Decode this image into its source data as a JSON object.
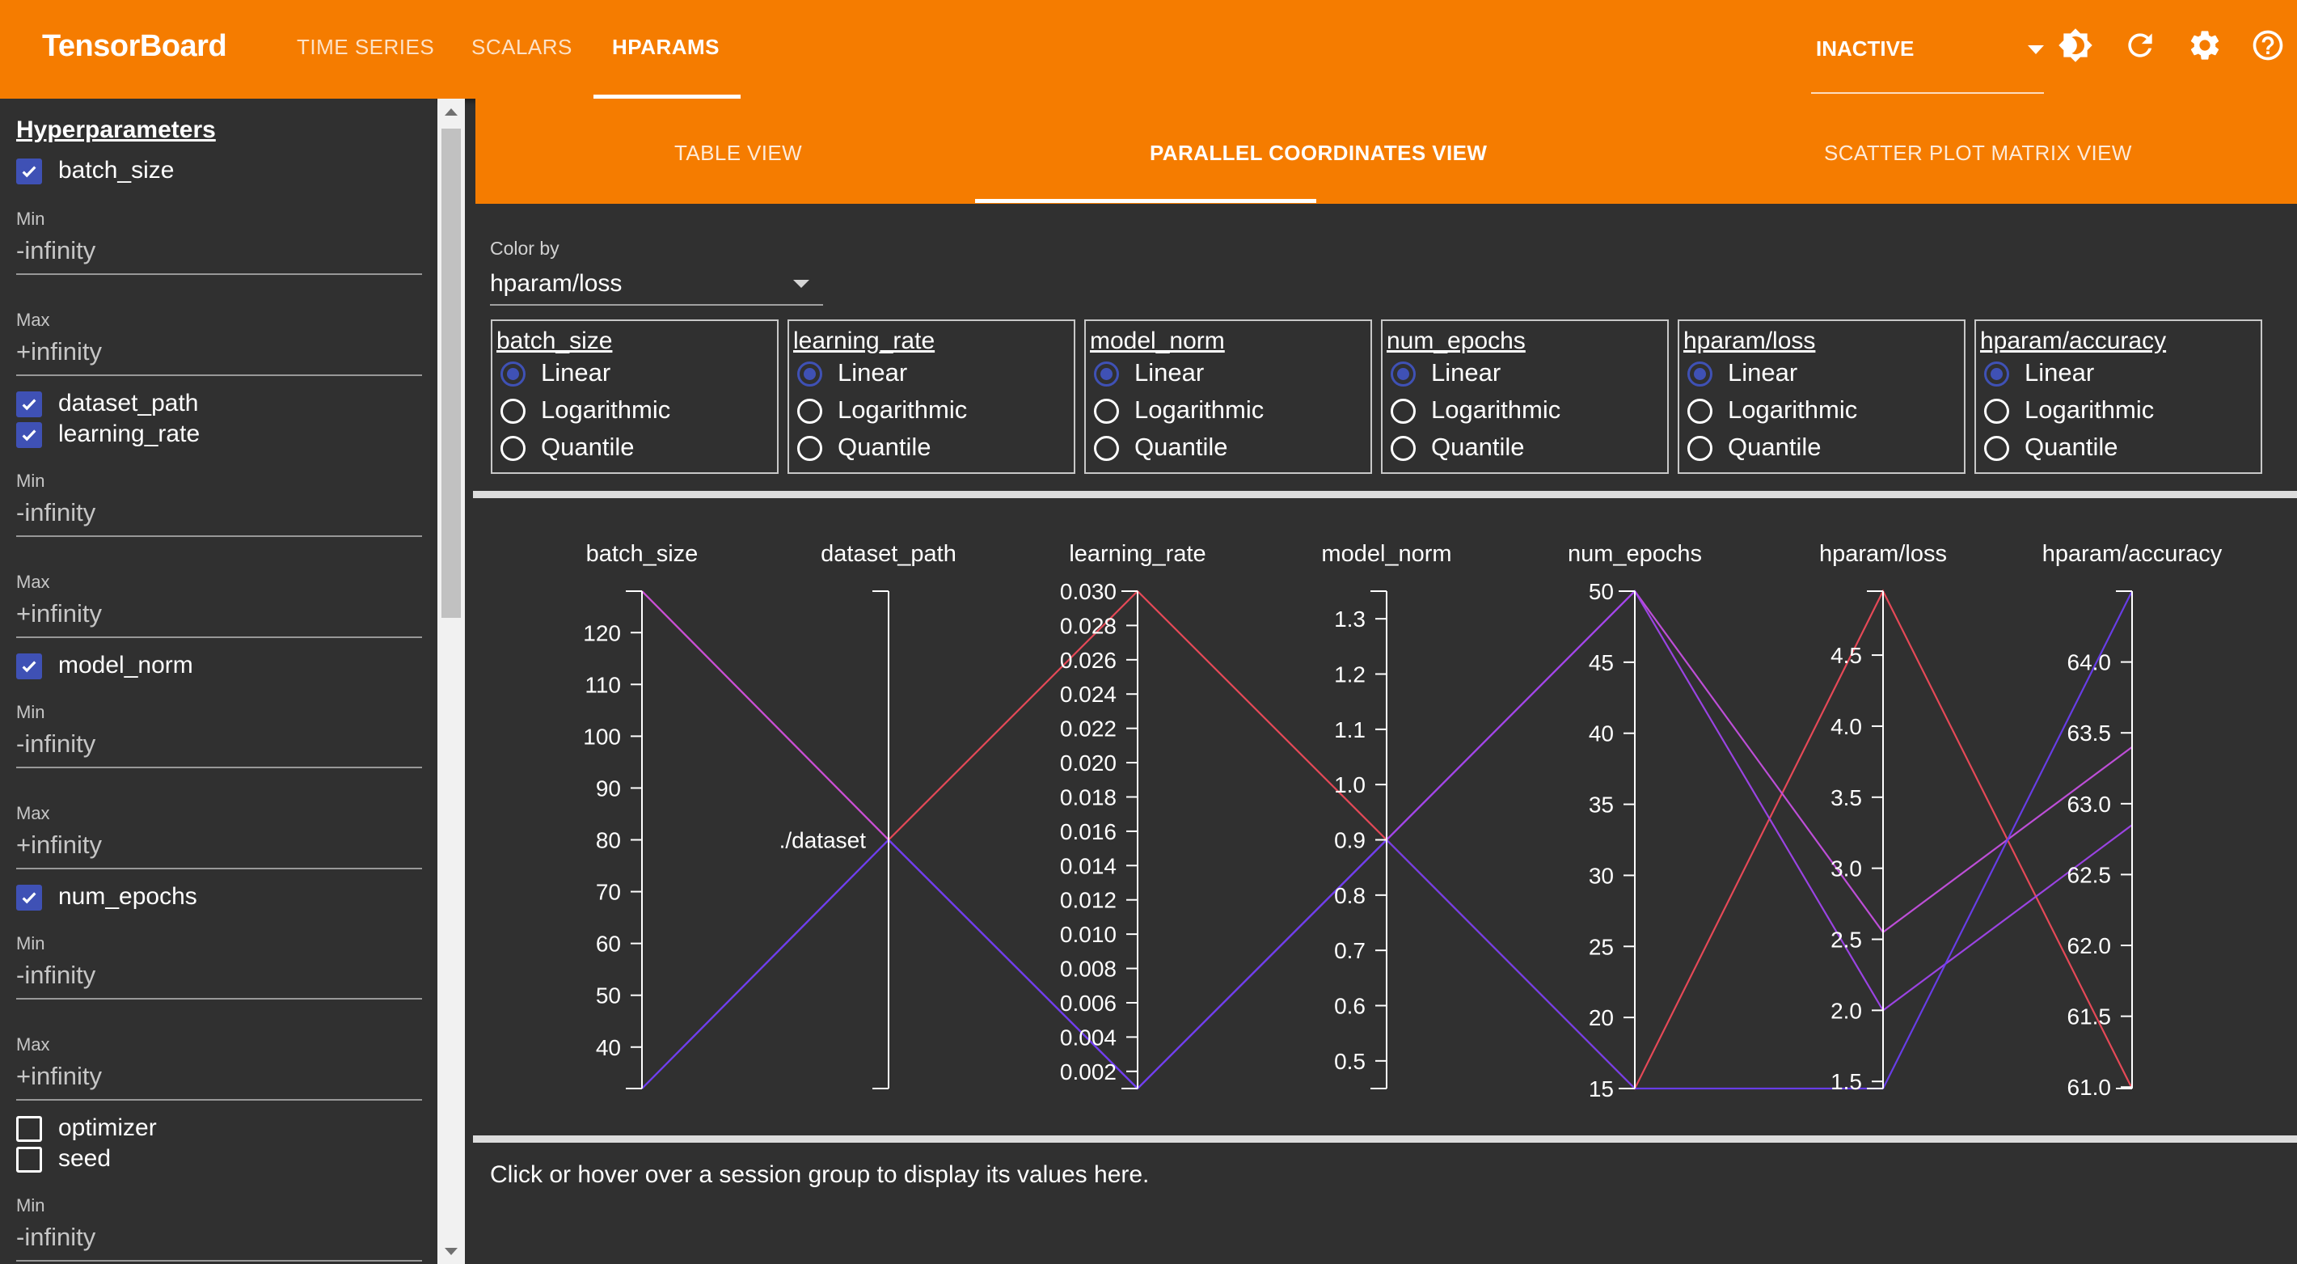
{
  "app": {
    "title": "TensorBoard",
    "nav_tabs": [
      {
        "label": "TIME SERIES",
        "active": false
      },
      {
        "label": "SCALARS",
        "active": false
      },
      {
        "label": "HPARAMS",
        "active": true
      }
    ],
    "run_selector": "INACTIVE",
    "toolbar_icons": [
      "theme-icon",
      "refresh-icon",
      "settings-icon",
      "help-icon"
    ]
  },
  "colors": {
    "accent": "#f57c00",
    "background": "#303030",
    "selection": "#3f51b5"
  },
  "sidebar": {
    "title": "Hyperparameters",
    "items": [
      {
        "name": "batch_size",
        "checked": true,
        "min_label": "Min",
        "min_value": "-infinity",
        "max_label": "Max",
        "max_value": "+infinity"
      },
      {
        "name": "dataset_path",
        "checked": true
      },
      {
        "name": "learning_rate",
        "checked": true,
        "min_label": "Min",
        "min_value": "-infinity",
        "max_label": "Max",
        "max_value": "+infinity"
      },
      {
        "name": "model_norm",
        "checked": true,
        "min_label": "Min",
        "min_value": "-infinity",
        "max_label": "Max",
        "max_value": "+infinity"
      },
      {
        "name": "num_epochs",
        "checked": true,
        "min_label": "Min",
        "min_value": "-infinity",
        "max_label": "Max",
        "max_value": "+infinity"
      },
      {
        "name": "optimizer",
        "checked": false
      },
      {
        "name": "seed",
        "checked": false,
        "min_label": "Min",
        "min_value": "-infinity"
      }
    ]
  },
  "view_tabs": [
    {
      "label": "TABLE VIEW",
      "active": false
    },
    {
      "label": "PARALLEL COORDINATES VIEW",
      "active": true
    },
    {
      "label": "SCATTER PLOT MATRIX VIEW",
      "active": false
    }
  ],
  "color_by": {
    "label": "Color by",
    "value": "hparam/loss"
  },
  "scale_options": [
    "Linear",
    "Logarithmic",
    "Quantile"
  ],
  "scale_columns": [
    {
      "name": "batch_size",
      "selected": "Linear"
    },
    {
      "name": "learning_rate",
      "selected": "Linear"
    },
    {
      "name": "model_norm",
      "selected": "Linear"
    },
    {
      "name": "num_epochs",
      "selected": "Linear"
    },
    {
      "name": "hparam/loss",
      "selected": "Linear"
    },
    {
      "name": "hparam/accuracy",
      "selected": "Linear"
    }
  ],
  "chart_data": {
    "type": "parallel_coordinates",
    "axes": [
      {
        "name": "batch_size",
        "kind": "linear",
        "range": [
          32,
          128
        ],
        "ticks": [
          40,
          50,
          60,
          70,
          80,
          90,
          100,
          110,
          120
        ]
      },
      {
        "name": "dataset_path",
        "kind": "categorical",
        "categories": [
          "./dataset"
        ]
      },
      {
        "name": "learning_rate",
        "kind": "linear",
        "range": [
          0.001,
          0.03
        ],
        "ticks": [
          "0.002",
          "0.004",
          "0.006",
          "0.008",
          "0.010",
          "0.012",
          "0.014",
          "0.016",
          "0.018",
          "0.020",
          "0.022",
          "0.024",
          "0.026",
          "0.028",
          "0.030"
        ]
      },
      {
        "name": "model_norm",
        "kind": "linear",
        "range": [
          0.45,
          1.35
        ],
        "ticks": [
          "0.5",
          "0.6",
          "0.7",
          "0.8",
          "0.9",
          "1.0",
          "1.1",
          "1.2",
          "1.3"
        ]
      },
      {
        "name": "num_epochs",
        "kind": "linear",
        "range": [
          15,
          50
        ],
        "ticks": [
          15,
          20,
          25,
          30,
          35,
          40,
          45,
          50
        ]
      },
      {
        "name": "hparam/loss",
        "kind": "linear",
        "range": [
          1.45,
          4.95
        ],
        "ticks": [
          "1.5",
          "2.0",
          "2.5",
          "3.0",
          "3.5",
          "4.0",
          "4.5"
        ]
      },
      {
        "name": "hparam/accuracy",
        "kind": "linear",
        "range": [
          60.99,
          64.5
        ],
        "ticks": [
          "61.0",
          "61.5",
          "62.0",
          "62.5",
          "63.0",
          "63.5",
          "64.0"
        ]
      }
    ],
    "sessions": [
      {
        "values": [
          128,
          "./dataset",
          0.03,
          0.9,
          15,
          4.95,
          60.99
        ],
        "color": "#ef4b5a"
      },
      {
        "values": [
          128,
          "./dataset",
          0.001,
          0.9,
          50,
          2.55,
          63.4
        ],
        "color": "#c550e0"
      },
      {
        "values": [
          32,
          "./dataset",
          0.001,
          0.9,
          50,
          2.0,
          62.85
        ],
        "color": "#a044ec"
      },
      {
        "values": [
          32,
          "./dataset",
          0.001,
          0.9,
          15,
          1.45,
          64.5
        ],
        "color": "#6a3ef0"
      }
    ]
  },
  "status_text": "Click or hover over a session group to display its values here."
}
